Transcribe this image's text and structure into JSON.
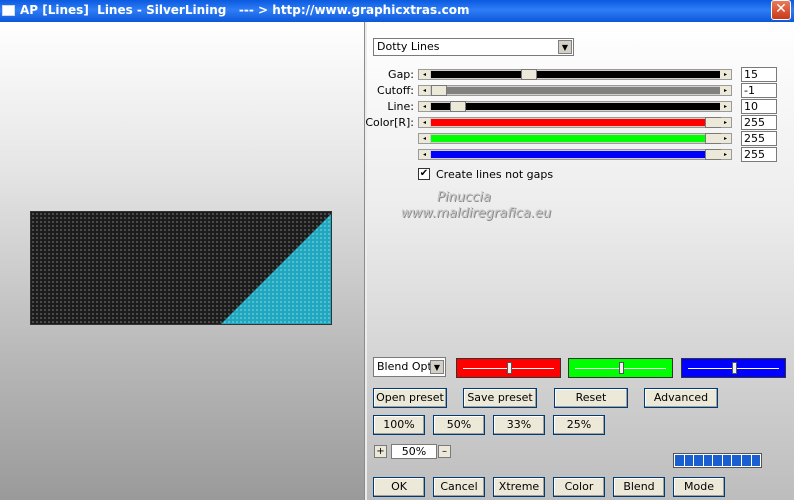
{
  "window": {
    "title": "AP [Lines]  Lines - SilverLining   --- > http://www.graphicxtras.com",
    "close_label": "✕"
  },
  "effect_dropdown": {
    "value": "Dotty Lines"
  },
  "sliders": [
    {
      "label": "Gap:",
      "value": "15",
      "fill_color": "#000000",
      "position": 0.33
    },
    {
      "label": "Cutoff:",
      "value": "-1",
      "fill_color": "#808080",
      "position": 0.0
    },
    {
      "label": "Line:",
      "value": "10",
      "fill_color": "#000000",
      "position": 0.07
    },
    {
      "label": "Color[R]:",
      "value": "255",
      "fill_color": "#ff0000",
      "position": 1.0
    },
    {
      "label": "",
      "value": "255",
      "fill_color": "#00ff00",
      "position": 1.0
    },
    {
      "label": "",
      "value": "255",
      "fill_color": "#0000ff",
      "position": 1.0
    }
  ],
  "checkbox": {
    "label": "Create lines not gaps",
    "checked": true,
    "mark": "✔"
  },
  "watermark": {
    "line1": "Pinuccia",
    "line2": "www.maldiregrafica.eu"
  },
  "blend_dropdown": {
    "value": "Blend Optio"
  },
  "color_boxes": [
    {
      "color": "#ff0000",
      "position": 0.5
    },
    {
      "color": "#00ff00",
      "position": 0.5
    },
    {
      "color": "#0000ff",
      "position": 0.5
    }
  ],
  "preset_buttons": {
    "open": "Open preset",
    "save": "Save preset",
    "reset": "Reset",
    "advanced": "Advanced"
  },
  "zoom_buttons": [
    "100%",
    "50%",
    "33%",
    "25%"
  ],
  "zoom": {
    "plus": "+",
    "value": "50%",
    "minus": "–"
  },
  "progress": {
    "cells": 9,
    "filled": 9
  },
  "bottom_buttons": {
    "ok": "OK",
    "cancel": "Cancel",
    "xtreme": "Xtreme",
    "color": "Color",
    "blend": "Blend",
    "mode": "Mode"
  },
  "colors": {
    "preview_dark": "#1c1c1c",
    "preview_teal": "#1fa7bf",
    "titlebar": "#0a5ae0"
  }
}
